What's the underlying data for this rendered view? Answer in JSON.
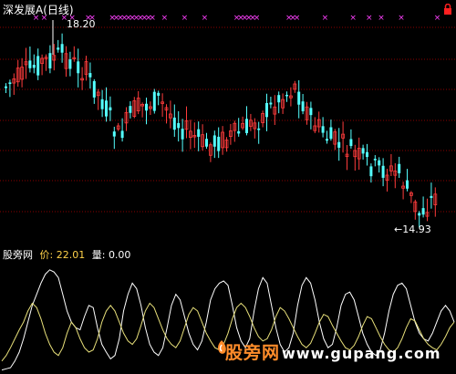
{
  "chart_title": "深发展A(日线)",
  "high_label": "18.20",
  "low_label": "←14.93",
  "indicator": {
    "name": "股旁网",
    "price_label": "价:",
    "price_value": "22.01",
    "volume_label": "量:",
    "volume_value": "0.00"
  },
  "watermark": {
    "text": "股旁网",
    "url": "www.gupang.com"
  },
  "colors": {
    "up": "#ff3c3c",
    "down": "#54ffff",
    "signal": "#ff40ff",
    "grid": "#8b0000",
    "line_white": "#ffffff",
    "line_yellow": "#e8e07a",
    "corner_icon": "#ff2020"
  },
  "icons": {
    "corner": "lock-icon"
  },
  "chart_data": [
    {
      "type": "candlestick",
      "title": "深发展A(日线)",
      "annotations": [
        {
          "text": "18.20",
          "kind": "period-high"
        },
        {
          "text": "14.93",
          "kind": "period-low"
        }
      ],
      "signal_marker": "×",
      "signal_days": [
        7,
        9,
        14,
        16,
        20,
        21,
        26,
        27,
        28,
        29,
        30,
        31,
        32,
        33,
        34,
        35,
        36,
        39,
        44,
        49,
        57,
        58,
        59,
        60,
        61,
        62,
        70,
        71,
        72,
        79,
        86,
        90,
        93,
        98,
        107
      ]
    },
    {
      "type": "line",
      "title": "股旁网",
      "series": [
        {
          "color": "#ffffff",
          "values": [
            2,
            3,
            4,
            10,
            18,
            30,
            45,
            60,
            70,
            80,
            88,
            92,
            90,
            85,
            70,
            55,
            45,
            40,
            38,
            50,
            60,
            58,
            40,
            25,
            18,
            12,
            15,
            30,
            55,
            70,
            80,
            75,
            60,
            40,
            25,
            18,
            15,
            22,
            40,
            60,
            70,
            65,
            50,
            35,
            25,
            20,
            28,
            45,
            65,
            75,
            80,
            82,
            78,
            60,
            40,
            28,
            22,
            30,
            55,
            75,
            85,
            80,
            60,
            40,
            25,
            18,
            22,
            35,
            60,
            78,
            85,
            80,
            65,
            45,
            30,
            22,
            25,
            40,
            60,
            70,
            72,
            65,
            50,
            35,
            25,
            18,
            15,
            20,
            35,
            55,
            70,
            78,
            80,
            75,
            60,
            45,
            35,
            30,
            28,
            35,
            45,
            55,
            60,
            55,
            45
          ]
        },
        {
          "color": "#e8e07a",
          "values": [
            10,
            15,
            22,
            30,
            38,
            45,
            55,
            62,
            58,
            48,
            35,
            25,
            18,
            15,
            22,
            35,
            45,
            40,
            30,
            22,
            18,
            20,
            30,
            45,
            55,
            60,
            55,
            45,
            35,
            28,
            25,
            30,
            42,
            55,
            62,
            58,
            48,
            38,
            30,
            25,
            22,
            28,
            40,
            52,
            58,
            55,
            45,
            35,
            28,
            22,
            20,
            25,
            35,
            48,
            58,
            62,
            58,
            50,
            40,
            32,
            28,
            30,
            38,
            50,
            58,
            55,
            48,
            40,
            32,
            25,
            22,
            26,
            35,
            45,
            52,
            50,
            42,
            35,
            28,
            22,
            20,
            24,
            32,
            42,
            50,
            48,
            40,
            32,
            25,
            20,
            18,
            22,
            30,
            40,
            48,
            46,
            38,
            30,
            25,
            22,
            20,
            25,
            32,
            40,
            45
          ]
        }
      ]
    }
  ]
}
